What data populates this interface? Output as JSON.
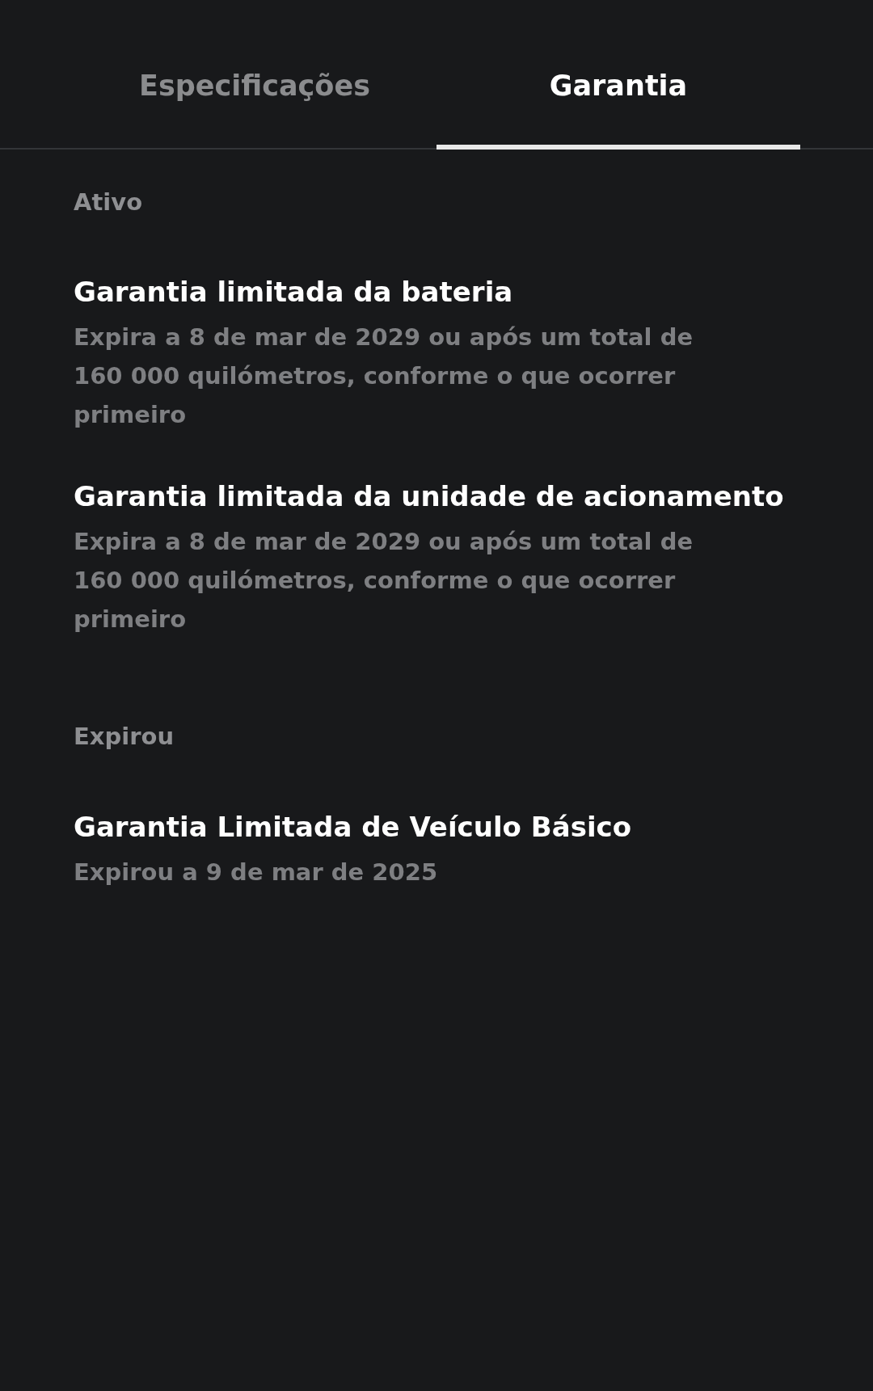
{
  "tabs": [
    {
      "label": "Especificações",
      "selected": false
    },
    {
      "label": "Garantia",
      "selected": true
    }
  ],
  "sections": [
    {
      "label": "Ativo",
      "items": [
        {
          "title": "Garantia limitada da bateria",
          "detail": "Expira a 8 de mar de 2029 ou após um total de 160 000 quilómetros, conforme o que ocorrer primeiro"
        },
        {
          "title": "Garantia limitada da unidade de acionamento",
          "detail": "Expira a 8 de mar de 2029 ou após um total de 160 000 quilómetros, conforme o que ocorrer primeiro"
        }
      ]
    },
    {
      "label": "Expirou",
      "items": [
        {
          "title": "Garantia Limitada de Veículo Básico",
          "detail": "Expirou a 9 de mar de 2025"
        }
      ]
    }
  ]
}
